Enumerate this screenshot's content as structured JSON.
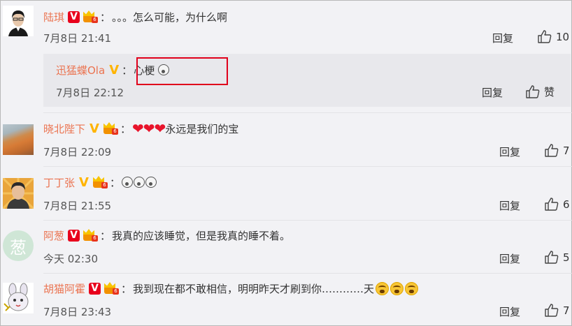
{
  "comments": [
    {
      "name": "陆琪",
      "text": "。。。怎么可能，为什么啊",
      "time": "7月8日 21:41",
      "reply": "回复",
      "likes": "10",
      "reply_thread": {
        "name": "迅猛蝶Ola",
        "text": "心梗",
        "time": "7月8日 22:12",
        "reply": "回复",
        "likes": "赞"
      }
    },
    {
      "name": "晓北陛下",
      "text": "永远是我们的宝",
      "time": "7月8日 22:09",
      "reply": "回复",
      "likes": "7"
    },
    {
      "name": "丁丁张",
      "text": "",
      "time": "7月8日 21:55",
      "reply": "回复",
      "likes": "6"
    },
    {
      "name": "阿葱",
      "text": "我真的应该睡觉，但是我真的睡不着。",
      "time": "今天 02:30",
      "reply": "回复",
      "likes": "5"
    },
    {
      "name": "胡猫阿霍",
      "text": "我到现在都不敢相信，明明昨天才刷到你…………天",
      "time": "7月8日 23:43",
      "reply": "回复",
      "likes": "7"
    }
  ],
  "colon": "：",
  "avatar_text": {
    "a": "葱"
  },
  "colors": {
    "name": "#eb7350",
    "badge": "#ffb400",
    "highlight": "#e0001b",
    "background": "#f2f2f5"
  }
}
